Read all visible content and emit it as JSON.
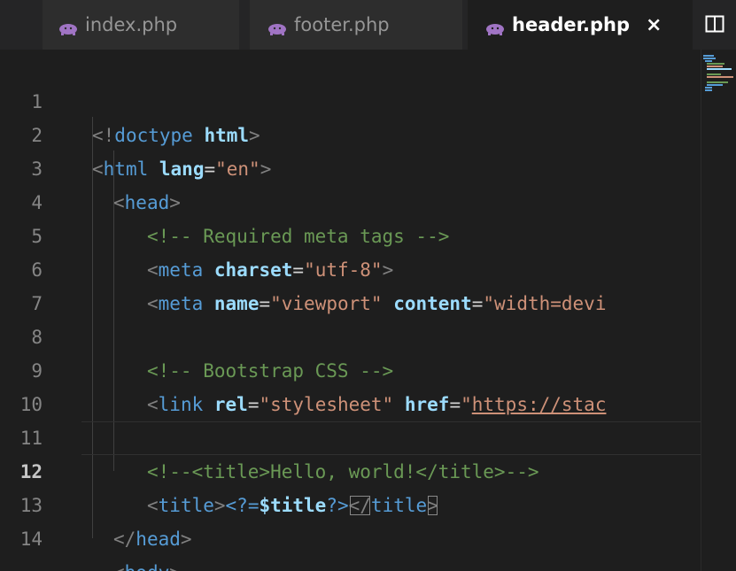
{
  "tabs": [
    {
      "label": "index.php",
      "active": false,
      "icon": "php-elephant-icon"
    },
    {
      "label": "footer.php",
      "active": false,
      "icon": "php-elephant-icon"
    },
    {
      "label": "header.php",
      "active": true,
      "icon": "php-elephant-icon",
      "close": "×"
    }
  ],
  "split_editor_icon": "split-editor-icon",
  "colors": {
    "editor_bg": "#1e1e1e",
    "tag": "#569cd6",
    "attribute": "#9cdcfe",
    "string": "#ce9178",
    "comment": "#6a9955",
    "php_icon": "#a074c4"
  },
  "editor": {
    "current_line": 12,
    "lines": [
      {
        "n": "1"
      },
      {
        "n": "2"
      },
      {
        "n": "3"
      },
      {
        "n": "4"
      },
      {
        "n": "5"
      },
      {
        "n": "6"
      },
      {
        "n": "7"
      },
      {
        "n": "8"
      },
      {
        "n": "9"
      },
      {
        "n": "10"
      },
      {
        "n": "11"
      },
      {
        "n": "12"
      },
      {
        "n": "13"
      },
      {
        "n": "14"
      }
    ],
    "code": {
      "l1": {
        "open": "<!",
        "kw": "doctype",
        "attr": "html",
        "close": ">"
      },
      "l2": {
        "open": "<",
        "tag": "html",
        "attr": "lang",
        "eq": "=",
        "val": "\"en\"",
        "close": ">"
      },
      "l3": {
        "open": "<",
        "tag": "head",
        "close": ">"
      },
      "l4": {
        "comment": "<!-- Required meta tags -->"
      },
      "l5": {
        "open": "<",
        "tag": "meta",
        "attr": "charset",
        "eq": "=",
        "val": "\"utf-8\"",
        "close": ">"
      },
      "l6": {
        "open": "<",
        "tag": "meta",
        "attr1": "name",
        "eq": "=",
        "val1": "\"viewport\"",
        "attr2": "content",
        "val2": "\"width=devi"
      },
      "l8": {
        "comment": "<!-- Bootstrap CSS -->"
      },
      "l9": {
        "open": "<",
        "tag": "link",
        "attr1": "rel",
        "eq": "=",
        "val1": "\"stylesheet\"",
        "attr2": "href",
        "q": "\"",
        "url": "https://stac"
      },
      "l11": {
        "comment": "<!--<title>Hello, world!</title>-->"
      },
      "l12": {
        "open": "<",
        "tag": "title",
        "close": ">",
        "php_open": "<?=",
        "var": "$title",
        "php_close": "?>",
        "end_open": "</",
        "end_close": ">"
      },
      "l13": {
        "end_open": "</",
        "tag": "head",
        "close": ">"
      },
      "l14": {
        "open": "<",
        "tag": "body",
        "close": ">"
      }
    }
  }
}
